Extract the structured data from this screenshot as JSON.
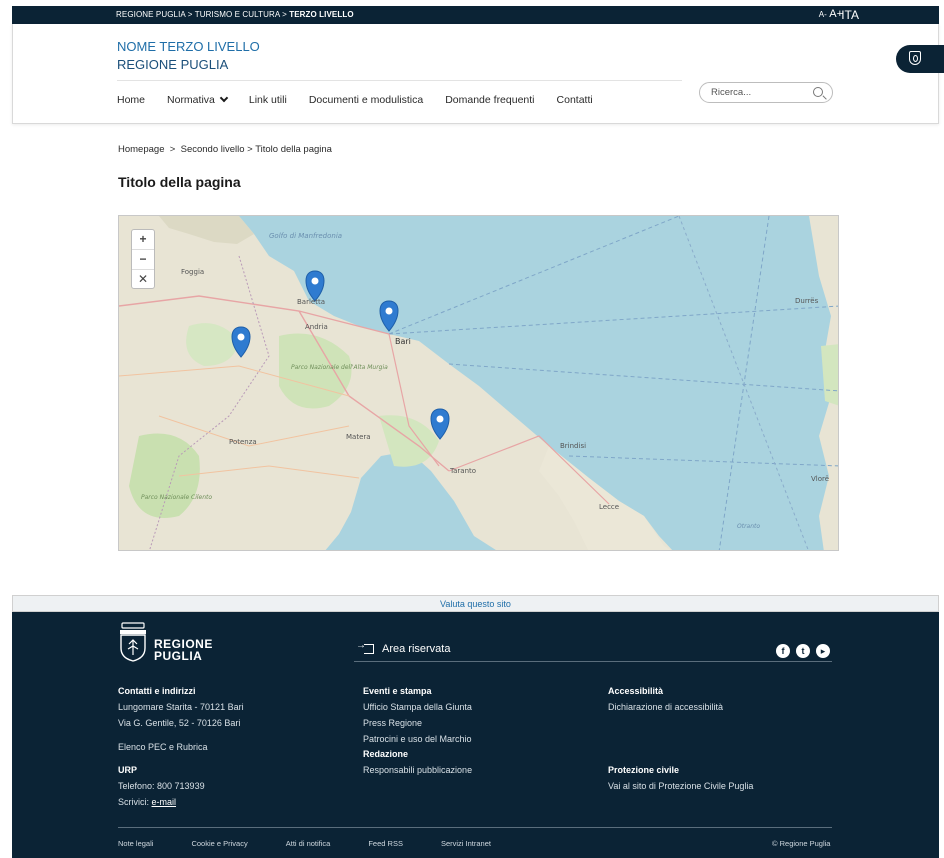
{
  "topbar": {
    "crumb_1": "REGIONE PUGLIA",
    "crumb_2": "TURISMO E CULTURA",
    "crumb_current": "TERZO LIVELLO",
    "font_decrease": "A-",
    "font_increase": "A+",
    "language": "ITA"
  },
  "header": {
    "title": "NOME TERZO LIVELLO",
    "subtitle": "REGIONE PUGLIA",
    "nav": [
      "Home",
      "Normativa",
      "Link utili",
      "Documenti e modulistica",
      "Domande frequenti",
      "Contatti"
    ],
    "search_placeholder": "Ricerca..."
  },
  "content": {
    "breadcrumb": [
      "Homepage",
      "Secondo livello",
      "Titolo della pagina"
    ],
    "breadcrumb_sep": ">",
    "page_title": "Titolo della pagina"
  },
  "map": {
    "labels": {
      "foggia": "Foggia",
      "barletta": "Barletta",
      "andria": "Andria",
      "bari": "Bari",
      "potenza": "Potenza",
      "matera": "Matera",
      "brindisi": "Brindisi",
      "taranto": "Taranto",
      "lecce": "Lecce",
      "durres": "Durrës",
      "vlore": "Vlorë",
      "gulf": "Golfo di Manfredonia",
      "park_1": "Parco Nazionale dell'Alta Murgia",
      "park_2": "Parco Nazionale Cilento",
      "otranto": "Otranto"
    },
    "controls": [
      "+",
      "−",
      "✕"
    ]
  },
  "footer": {
    "rate_site": "Valuta questo sito",
    "logo_line_1": "REGIONE",
    "logo_line_2": "PUGLIA",
    "area_riservata": "Area riservata",
    "contacts": {
      "heading": "Contatti e indirizzi",
      "line_1": "Lungomare Starita - 70121 Bari",
      "line_2": "Via G. Gentile, 52 - 70126 Bari",
      "pec": "Elenco PEC e Rubrica",
      "urp_heading": "URP",
      "phone": "Telefono: 800 713939",
      "write_prefix": "Scrivici: ",
      "email": "e-mail"
    },
    "events": {
      "heading": "Eventi e stampa",
      "items": [
        "Ufficio Stampa della Giunta",
        "Press Regione",
        "Patrocini e uso del Marchio"
      ],
      "redazione_heading": "Redazione",
      "redazione_item": "Responsabili pubblicazione"
    },
    "accessibility": {
      "heading": "Accessibilità",
      "item": "Dichiarazione di accessibilità",
      "civil_heading": "Protezione civile",
      "civil_item": "Vai al sito di Protezione Civile Puglia"
    },
    "bottom_links": [
      "Note legali",
      "Cookie e Privacy",
      "Atti di notifica",
      "Feed RSS",
      "Servizi Intranet"
    ],
    "copyright": "© Regione Puglia"
  }
}
